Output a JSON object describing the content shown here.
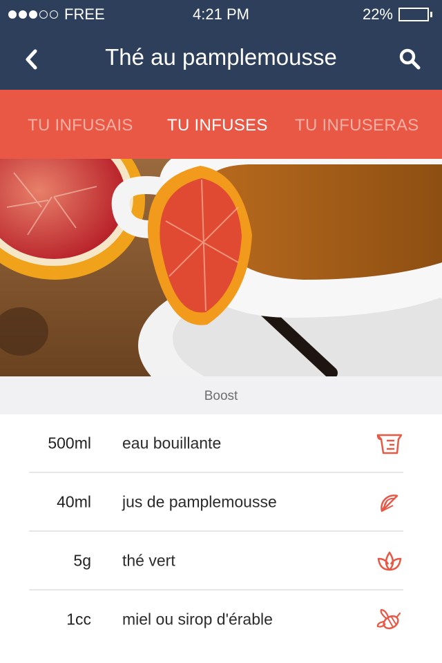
{
  "status_bar": {
    "carrier": "FREE",
    "signal_full": 3,
    "signal_total": 5,
    "time": "4:21  PM",
    "battery_percent": "22%",
    "battery_level": 0.22
  },
  "nav": {
    "title": "Thé au pamplemousse",
    "back_icon": "chevron-left-icon",
    "search_icon": "search-icon"
  },
  "tabs": [
    {
      "label": "TU INFUSAIS",
      "active": false
    },
    {
      "label": "TU INFUSES",
      "active": true
    },
    {
      "label": "TU INFUSERAS",
      "active": false
    }
  ],
  "caption": "Boost",
  "ingredients": [
    {
      "qty": "500ml",
      "name": "eau bouillante",
      "icon": "measuring-cup-icon"
    },
    {
      "qty": "40ml",
      "name": "jus de pamplemousse",
      "icon": "citrus-slice-icon"
    },
    {
      "qty": "5g",
      "name": "thé vert",
      "icon": "leaf-icon"
    },
    {
      "qty": "1cc",
      "name": "miel ou sirop d'érable",
      "icon": "bee-icon"
    }
  ],
  "colors": {
    "nav_bg": "#2e3f5c",
    "tabs_bg": "#e85845",
    "tab_active": "#ffffff",
    "tab_inactive": "#f7b0a5",
    "icon_accent": "#e85845"
  }
}
